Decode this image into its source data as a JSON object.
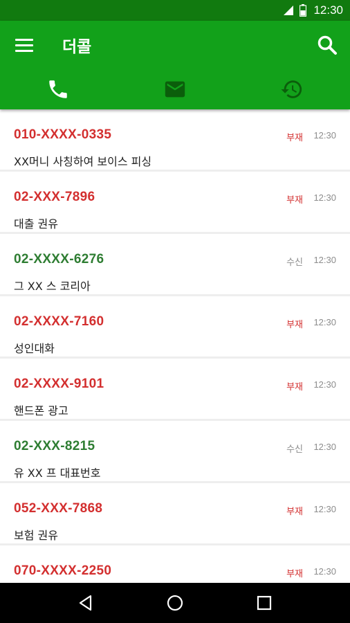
{
  "status_bar": {
    "time": "12:30"
  },
  "app_bar": {
    "title": "더콜"
  },
  "tabs": [
    {
      "name": "call",
      "icon": "phone-icon",
      "active": true
    },
    {
      "name": "message",
      "icon": "envelope-icon",
      "active": false
    },
    {
      "name": "history",
      "icon": "history-icon",
      "active": false
    }
  ],
  "colors": {
    "missed": "#d32f2f",
    "received": "#2e7d32",
    "app_bar": "#12a11a",
    "status_bar": "#117a0f"
  },
  "calls": [
    {
      "number": "010-XXXX-0335",
      "desc": " XX머니 사칭하여 보이스 피싱",
      "status": "부재",
      "time": "12:30",
      "type": "missed"
    },
    {
      "number": "02-XXX-7896",
      "desc": "대출 권유",
      "status": "부재",
      "time": "12:30",
      "type": "missed"
    },
    {
      "number": "02-XXXX-6276",
      "desc": "그 XX 스 코리아",
      "status": "수신",
      "time": "12:30",
      "type": "received"
    },
    {
      "number": "02-XXXX-7160",
      "desc": "성인대화",
      "status": "부재",
      "time": "12:30",
      "type": "missed"
    },
    {
      "number": "02-XXXX-9101",
      "desc": "핸드폰 광고",
      "status": "부재",
      "time": "12:30",
      "type": "missed"
    },
    {
      "number": "02-XXX-8215",
      "desc": "유 XX 프 대표번호",
      "status": "수신",
      "time": "12:30",
      "type": "received"
    },
    {
      "number": "052-XXX-7868",
      "desc": "보험 권유",
      "status": "부재",
      "time": "12:30",
      "type": "missed"
    },
    {
      "number": "070-XXXX-2250",
      "desc": "",
      "status": "부재",
      "time": "12:30",
      "type": "missed"
    }
  ]
}
